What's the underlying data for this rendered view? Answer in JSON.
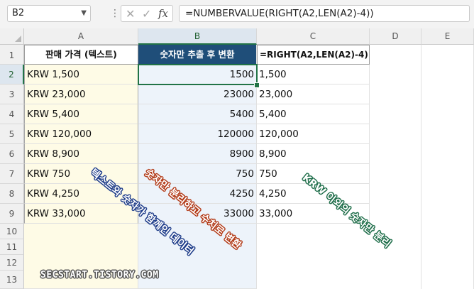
{
  "formula_bar": {
    "name_box": "B2",
    "fx_label": "fx",
    "formula": "=NUMBERVALUE(RIGHT(A2,LEN(A2)-4))"
  },
  "columns": [
    "A",
    "B",
    "C",
    "D",
    "E"
  ],
  "rows": [
    "1",
    "2",
    "3",
    "4",
    "5",
    "6",
    "7",
    "8",
    "9",
    "10",
    "11",
    "12",
    "13"
  ],
  "headers": {
    "a": "판매 가격 (텍스트)",
    "b": "숫자만 추출 후 변환",
    "c": "=RIGHT(A2,LEN(A2)-4)"
  },
  "data_rows": [
    {
      "a": "KRW 1,500",
      "b": "1500",
      "c": "1,500"
    },
    {
      "a": "KRW 23,000",
      "b": "23000",
      "c": "23,000"
    },
    {
      "a": "KRW 5,400",
      "b": "5400",
      "c": "5,400"
    },
    {
      "a": "KRW 120,000",
      "b": "120000",
      "c": "120,000"
    },
    {
      "a": "KRW 8,900",
      "b": "8900",
      "c": "8,900"
    },
    {
      "a": "KRW 750",
      "b": "750",
      "c": "750"
    },
    {
      "a": "KRW 4,250",
      "b": "4250",
      "c": "4,250"
    },
    {
      "a": "KRW 33,000",
      "b": "33000",
      "c": "33,000"
    }
  ],
  "annotations": {
    "blue": "텍스트와 숫자가 함께인 데이터",
    "red": "숫자만 분리하고 수치로 변환",
    "green": "KRW 이외의 숫자만 분리"
  },
  "watermark": "SECSTART.TISTORY.COM",
  "colors": {
    "accent": "#217346",
    "header_fill": "#1f4e79",
    "col_a_fill": "#fefbe6",
    "col_b_fill": "#edf3fa"
  },
  "active_cell": "B2"
}
